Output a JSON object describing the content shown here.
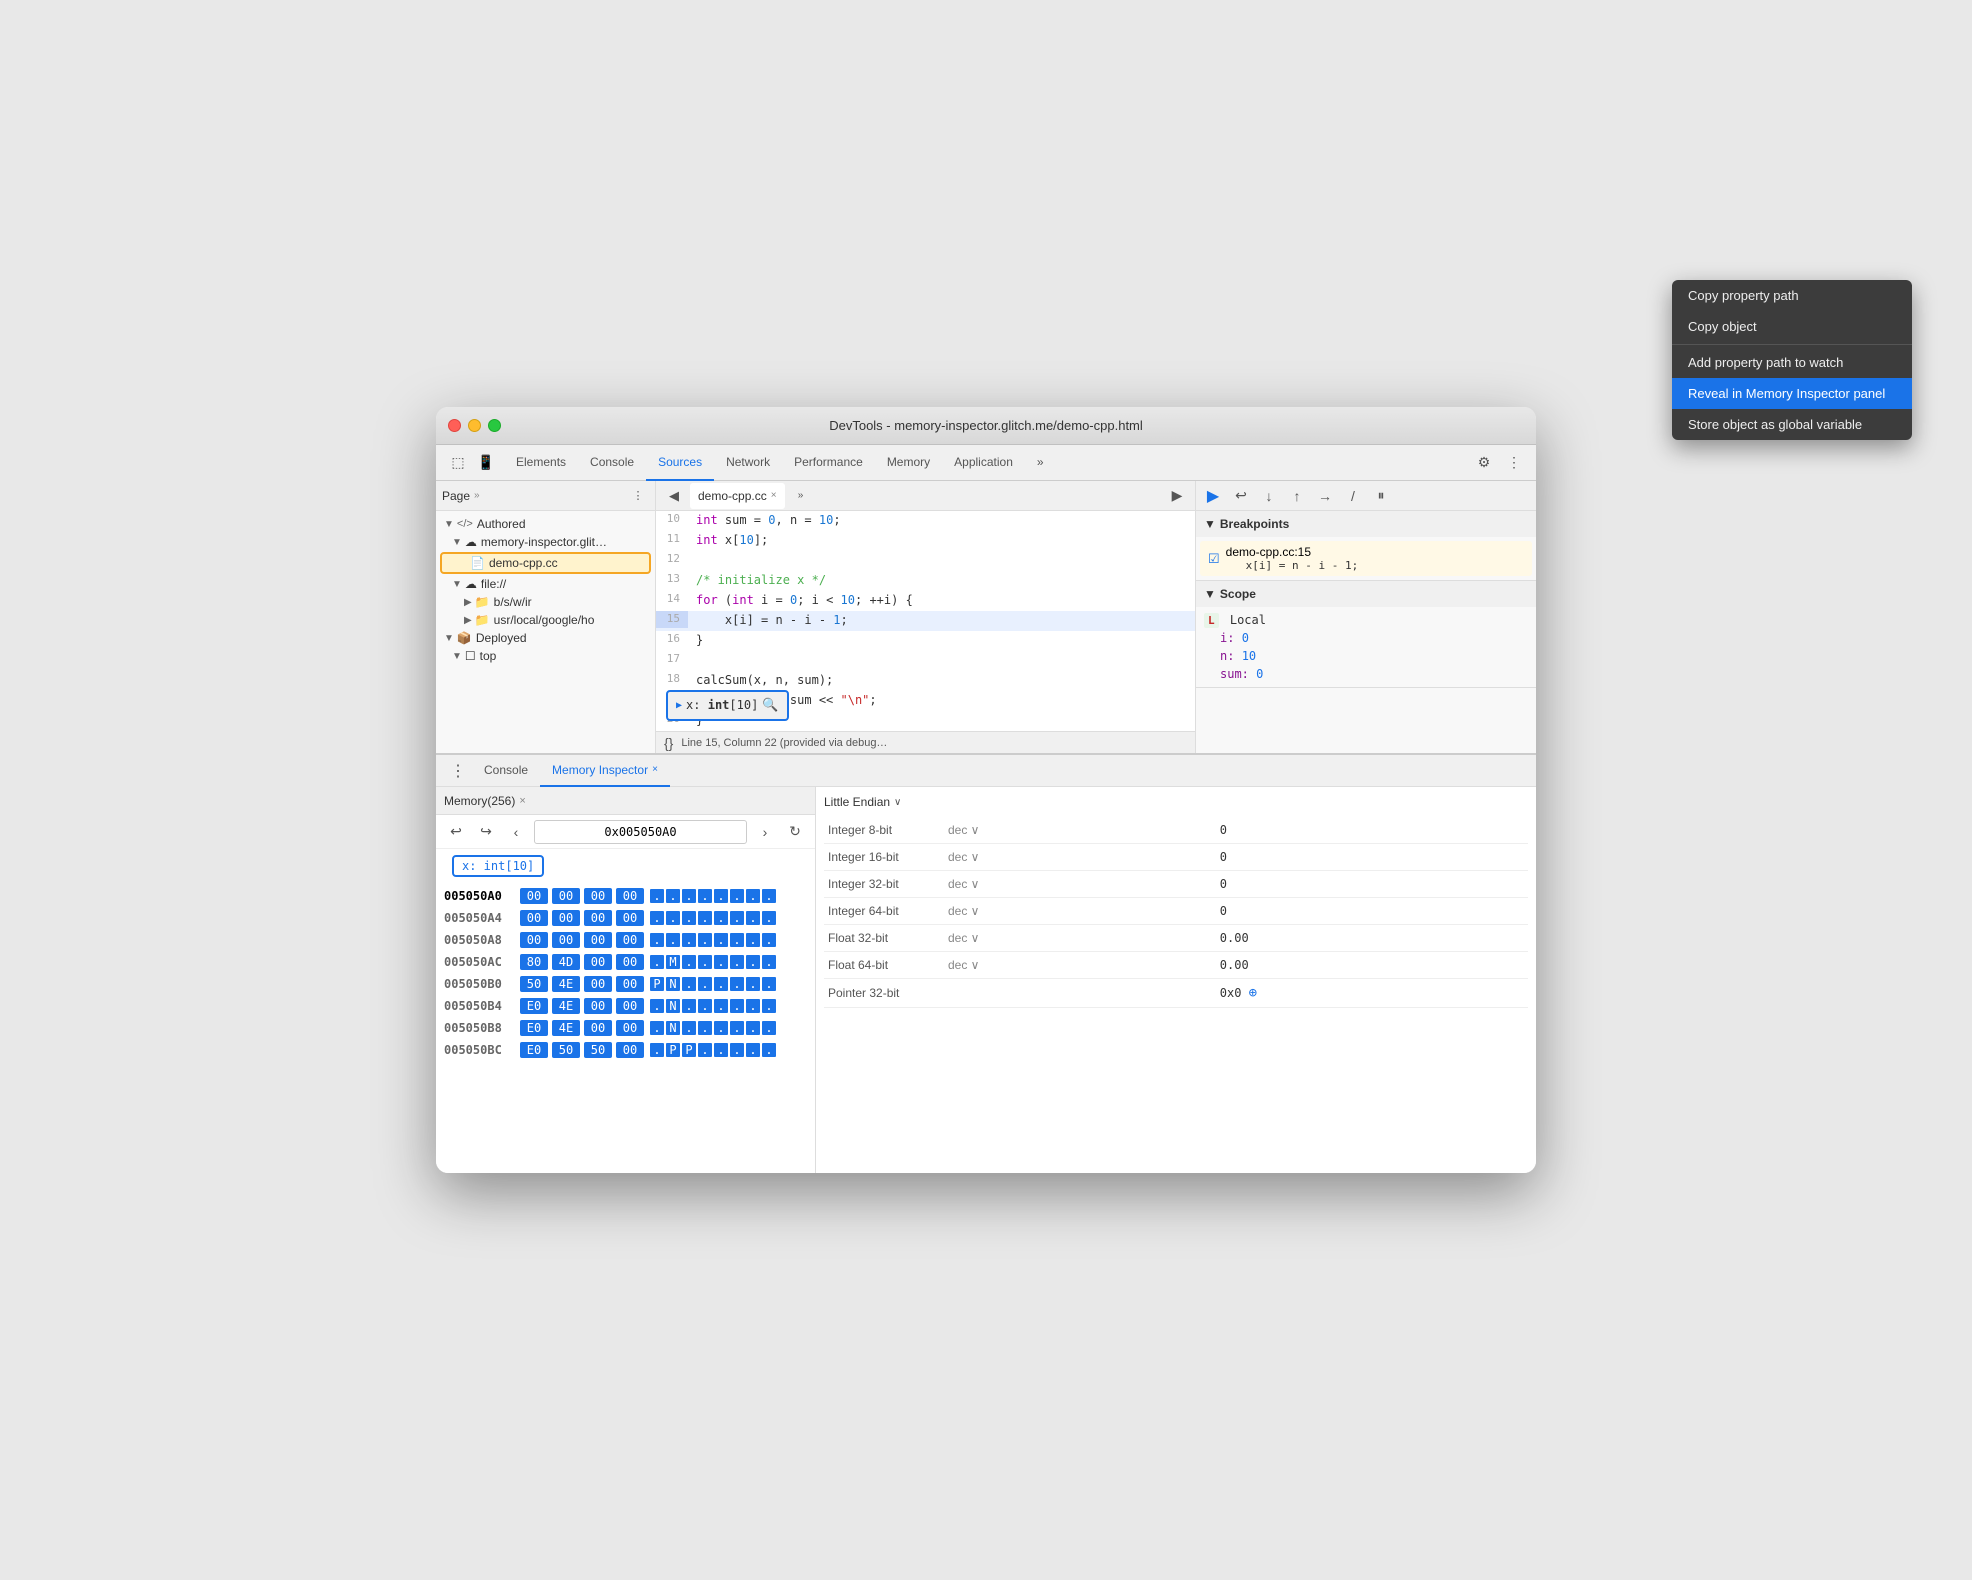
{
  "window": {
    "title": "DevTools - memory-inspector.glitch.me/demo-cpp.html"
  },
  "tabs": {
    "elements": "Elements",
    "console": "Console",
    "sources": "Sources",
    "network": "Network",
    "performance": "Performance",
    "memory": "Memory",
    "application": "Application",
    "more": "»"
  },
  "left_panel": {
    "label": "Page",
    "more": "»",
    "tree": [
      {
        "indent": 0,
        "icon": "</>",
        "label": "Authored",
        "expanded": true
      },
      {
        "indent": 1,
        "icon": "☁",
        "label": "memory-inspector.glit…",
        "expanded": true
      },
      {
        "indent": 2,
        "icon": "📄",
        "label": "demo-cpp.cc",
        "highlighted": true
      },
      {
        "indent": 1,
        "icon": "☁",
        "label": "file://",
        "expanded": true
      },
      {
        "indent": 2,
        "icon": "📁",
        "label": "b/s/w/ir",
        "expanded": false
      },
      {
        "indent": 2,
        "icon": "📁",
        "label": "usr/local/google/ho",
        "expanded": false
      },
      {
        "indent": 0,
        "icon": "📦",
        "label": "Deployed",
        "expanded": true
      },
      {
        "indent": 1,
        "icon": "☐",
        "label": "top",
        "expanded": true
      }
    ]
  },
  "editor": {
    "filename": "demo-cpp.cc",
    "lines": [
      {
        "num": 10,
        "code": "int sum = 0, n = 10;",
        "highlighted": false
      },
      {
        "num": 11,
        "code": "int x[10];",
        "highlighted": false
      },
      {
        "num": 12,
        "code": "",
        "highlighted": false
      },
      {
        "num": 13,
        "code": "/* initialize x */",
        "highlighted": false
      },
      {
        "num": 14,
        "code": "for (int i = 0; i < 10; ++i) {",
        "highlighted": false
      },
      {
        "num": 15,
        "code": "  x[i] = n - i - 1;",
        "highlighted": true
      },
      {
        "num": 16,
        "code": "}",
        "highlighted": false
      },
      {
        "num": 17,
        "code": "",
        "highlighted": false
      },
      {
        "num": 18,
        "code": "calcSum(x, n, sum);",
        "highlighted": false
      },
      {
        "num": 19,
        "code": "std::cout << sum << \"\\n\";",
        "highlighted": false
      },
      {
        "num": 20,
        "code": "}",
        "highlighted": false
      }
    ],
    "status": "Line 15, Column 22 (provided via debug…",
    "var_tooltip": "▶ x: int[10] 🔍"
  },
  "debugger": {
    "breakpoints_label": "Breakpoints",
    "breakpoint": {
      "file": "demo-cpp.cc:15",
      "code": "x[i] = n - i - 1;"
    },
    "scope_label": "Scope",
    "local_label": "Local",
    "variables": [
      {
        "key": "i:",
        "val": "0"
      },
      {
        "key": "n:",
        "val": "10"
      },
      {
        "key": "sum:",
        "val": "0"
      }
    ]
  },
  "bottom": {
    "console_tab": "Console",
    "memory_inspector_tab": "Memory Inspector",
    "memory_tab_close": "×",
    "memory_window": "Memory(256)",
    "memory_window_close": "×",
    "address": "0x005050A0",
    "tag": "x: int[10]",
    "rows": [
      {
        "addr": "005050A0",
        "bold": true,
        "bytes": [
          "00",
          "00",
          "00",
          "00"
        ],
        "ascii": [
          ".",
          ".",
          ".",
          ".",
          ".",
          ".",
          ".",
          "."
        ]
      },
      {
        "addr": "005050A4",
        "bold": false,
        "bytes": [
          "00",
          "00",
          "00",
          "00"
        ],
        "ascii": [
          ".",
          ".",
          ".",
          ".",
          ".",
          ".",
          ".",
          "."
        ]
      },
      {
        "addr": "005050A8",
        "bold": false,
        "bytes": [
          "00",
          "00",
          "00",
          "00"
        ],
        "ascii": [
          ".",
          ".",
          ".",
          ".",
          ".",
          ".",
          ".",
          "."
        ]
      },
      {
        "addr": "005050AC",
        "bold": false,
        "bytes": [
          "80",
          "4D",
          "00",
          "00"
        ],
        "ascii": [
          ".",
          "M",
          ".",
          ".",
          ".",
          ".",
          ".",
          "."
        ]
      },
      {
        "addr": "005050B0",
        "bold": false,
        "bytes": [
          "50",
          "4E",
          "00",
          "00"
        ],
        "ascii": [
          "P",
          "N",
          ".",
          ".",
          ".",
          ".",
          ".",
          "."
        ]
      },
      {
        "addr": "005050B4",
        "bold": false,
        "bytes": [
          "E0",
          "4E",
          "00",
          "00"
        ],
        "ascii": [
          ".",
          "N",
          ".",
          ".",
          ".",
          ".",
          ".",
          "."
        ]
      },
      {
        "addr": "005050B8",
        "bold": false,
        "bytes": [
          "E0",
          "4E",
          "00",
          "00"
        ],
        "ascii": [
          ".",
          "N",
          ".",
          ".",
          ".",
          ".",
          ".",
          "."
        ]
      },
      {
        "addr": "005050BC",
        "bold": false,
        "bytes": [
          "E0",
          "50",
          "50",
          "00"
        ],
        "ascii": [
          ".",
          "P",
          "P",
          ".",
          ".",
          ".",
          ".",
          "."
        ]
      }
    ],
    "endian": "Little Endian",
    "data_types": [
      {
        "label": "Integer 8-bit",
        "format": "dec",
        "value": "0"
      },
      {
        "label": "Integer 16-bit",
        "format": "dec",
        "value": "0"
      },
      {
        "label": "Integer 32-bit",
        "format": "dec",
        "value": "0"
      },
      {
        "label": "Integer 64-bit",
        "format": "dec",
        "value": "0"
      },
      {
        "label": "Float 32-bit",
        "format": "dec",
        "value": "0.00"
      },
      {
        "label": "Float 64-bit",
        "format": "dec",
        "value": "0.00"
      },
      {
        "label": "Pointer 32-bit",
        "format": "",
        "value": "0x0"
      }
    ]
  },
  "context_menu": {
    "items": [
      {
        "label": "Copy property path",
        "active": false,
        "divider": false
      },
      {
        "label": "Copy object",
        "active": false,
        "divider": false
      },
      {
        "label": "",
        "active": false,
        "divider": true
      },
      {
        "label": "Add property path to watch",
        "active": false,
        "divider": false
      },
      {
        "label": "Reveal in Memory Inspector panel",
        "active": true,
        "divider": false
      },
      {
        "label": "Store object as global variable",
        "active": false,
        "divider": false
      }
    ]
  }
}
